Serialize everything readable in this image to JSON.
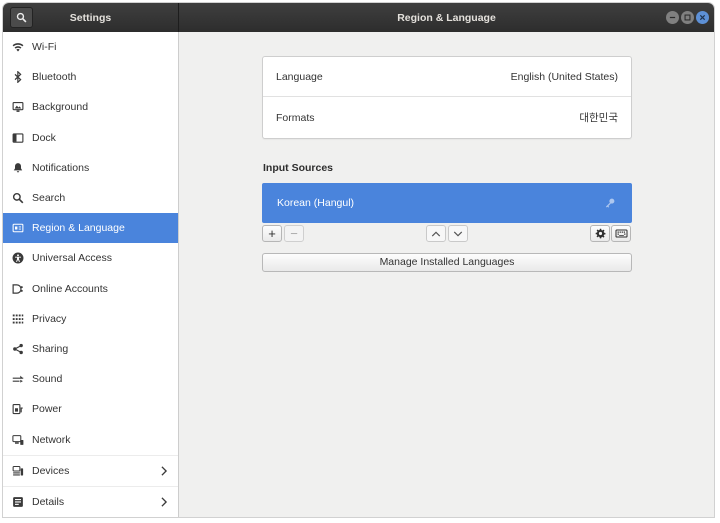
{
  "window": {
    "sidebar_title": "Settings",
    "title": "Region & Language",
    "header_search_icon": "search-icon",
    "controls": [
      "minimize-icon",
      "maximize-icon",
      "close-icon"
    ]
  },
  "colors": {
    "accent": "#4a84dc",
    "headerbar": "#333333",
    "close_button": "#5d90d6",
    "panel_background": "#f0f0ef"
  },
  "sidebar": {
    "items": [
      {
        "label": "Wi-Fi",
        "icon": "wifi-icon"
      },
      {
        "label": "Bluetooth",
        "icon": "bluetooth-icon"
      },
      {
        "label": "Background",
        "icon": "background-icon"
      },
      {
        "label": "Dock",
        "icon": "dock-icon"
      },
      {
        "label": "Notifications",
        "icon": "notifications-icon"
      },
      {
        "label": "Search",
        "icon": "search-icon"
      },
      {
        "label": "Region & Language",
        "icon": "region-icon",
        "selected": true
      },
      {
        "label": "Universal Access",
        "icon": "universal-access-icon"
      },
      {
        "label": "Online Accounts",
        "icon": "online-accounts-icon"
      },
      {
        "label": "Privacy",
        "icon": "privacy-icon"
      },
      {
        "label": "Sharing",
        "icon": "sharing-icon"
      },
      {
        "label": "Sound",
        "icon": "sound-icon"
      },
      {
        "label": "Power",
        "icon": "power-icon"
      },
      {
        "label": "Network",
        "icon": "network-icon"
      },
      {
        "label": "Devices",
        "icon": "devices-icon",
        "has_submenu": true
      },
      {
        "label": "Details",
        "icon": "details-icon",
        "has_submenu": true
      }
    ]
  },
  "language_settings": {
    "rows": [
      {
        "label": "Language",
        "value": "English (United States)"
      },
      {
        "label": "Formats",
        "value": "대한민국"
      }
    ]
  },
  "input_sources": {
    "heading": "Input Sources",
    "items": [
      {
        "label": "Korean (Hangul)",
        "selected": true,
        "icon": "key-icon"
      }
    ],
    "toolbar": {
      "add_label": "+",
      "remove_label": "−",
      "remove_enabled": false,
      "icons": [
        "chevron-up-icon",
        "chevron-down-icon",
        "gear-icon",
        "keyboard-icon"
      ]
    }
  },
  "manage_button": {
    "label": "Manage Installed Languages"
  }
}
